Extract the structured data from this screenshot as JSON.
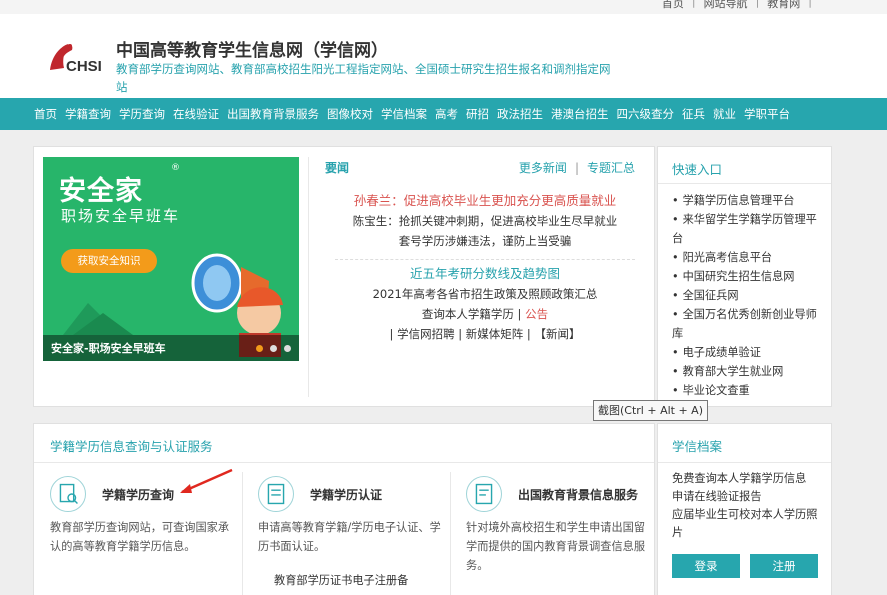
{
  "topbar": {
    "links": [
      "首页",
      "网站导航",
      "教育网"
    ]
  },
  "header": {
    "logo_text": "CHSI",
    "title": "中国高等教育学生信息网（学信网）",
    "subtitle": "教育部学历查询网站、教育部高校招生阳光工程指定网站、全国硕士研究生招生报名和调剂指定网站"
  },
  "nav": {
    "items": [
      "首页",
      "学籍查询",
      "学历查询",
      "在线验证",
      "出国教育背景服务",
      "图像校对",
      "学信档案",
      "高考",
      "研招",
      "政法招生",
      "港澳台招生",
      "四六级查分",
      "征兵",
      "就业",
      "学职平台"
    ]
  },
  "banner": {
    "brand": "安全家",
    "reg_mark": "®",
    "slogan": "职场安全早班车",
    "cta": "获取安全知识",
    "caption": "安全家-职场安全早班车"
  },
  "news": {
    "label": "要闻",
    "more": "更多新闻",
    "topics": "专题汇总",
    "headline1": "孙春兰：促进高校毕业生更加充分更高质量就业",
    "line1": "陈宝生：抢抓关键冲刺期，促进高校毕业生尽早就业",
    "line2": "套号学历涉嫌违法，谨防上当受骗",
    "headline2": "近五年考研分数线及趋势图",
    "line3": "2021年高考各省市招生政策及照顾政策汇总",
    "line4a": "查询本人学籍学历 | ",
    "line4b": "公告",
    "line4c": " | 学信网招聘 | 新媒体矩阵 | 【新闻】"
  },
  "quick": {
    "title": "快速入口",
    "items": [
      "学籍学历信息管理平台",
      "来华留学生学籍学历管理平台",
      "阳光高考信息平台",
      "中国研究生招生信息网",
      "全国征兵网",
      "全国万名优秀创新创业导师库",
      "电子成绩单验证",
      "教育部大学生就业网",
      "毕业论文查重"
    ]
  },
  "tooltip": "截图(Ctrl + Alt + A)",
  "services": {
    "title": "学籍学历信息查询与认证服务",
    "items": [
      {
        "name": "学籍学历查询",
        "desc": "教育部学历查询网站，可查询国家承认的高等教育学籍学历信息。"
      },
      {
        "name": "学籍学历认证",
        "desc": "申请高等教育学籍/学历电子认证、学历书面认证。"
      },
      {
        "name": "出国教育背景信息服务",
        "desc": "针对境外高校招生和学生申请出国留学而提供的国内教育背景调查信息服务。"
      }
    ],
    "sub_item": "教育部学历证书电子注册备"
  },
  "archive": {
    "title": "学信档案",
    "text": "免费查询本人学籍学历信息\n申请在线验证报告\n应届毕业生可校对本人学历照片",
    "login": "登录",
    "register": "注册"
  },
  "colors": {
    "accent": "#27a6ae",
    "red": "#d9534f",
    "banner_green": "#27b56a",
    "orange": "#f39b1a"
  }
}
